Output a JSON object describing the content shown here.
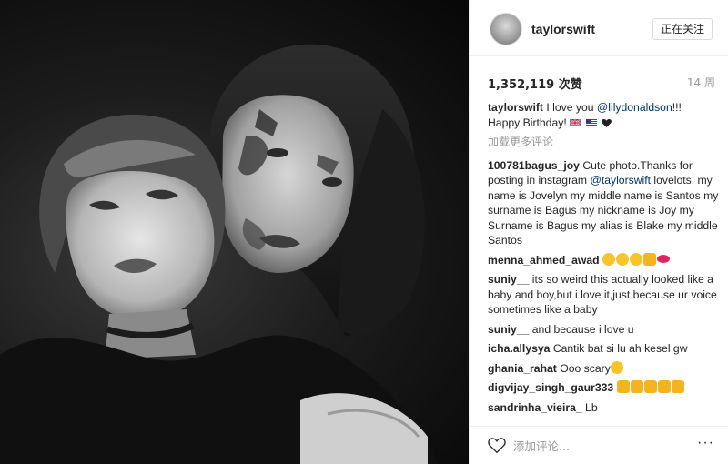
{
  "post": {
    "username": "taylorswift",
    "follow_label": "正在关注",
    "likes": "1,352,119 次赞",
    "timestamp": "14 周"
  },
  "caption": {
    "username": "taylorswift",
    "text_before": " I love you ",
    "mention": "@lilydonaldson",
    "text_after": "!!!",
    "line2": "Happy Birthday! "
  },
  "load_more": "加载更多评论",
  "comments": [
    {
      "user": "100781bagus_joy",
      "text_a": " Cute photo.Thanks for posting in instagram ",
      "mention": "@taylorswift",
      "text_b": " lovelots, my name is Jovelyn my middle name is Santos my surname is Bagus my nickname is Joy my Surname is Bagus my alias is Blake my middle Santos"
    },
    {
      "user": "menna_ahmed_awad",
      "text": " "
    },
    {
      "user": "suniy__",
      "text": " its so weird this actually looked like a baby and boy,but i love it,just because ur voice sometimes like a baby"
    },
    {
      "user": "suniy__",
      "text": " and because i love u"
    },
    {
      "user": "icha.allysya",
      "text": " Cantik bat si lu ah kesel gw"
    },
    {
      "user": "ghania_rahat",
      "text": " Ooo scary"
    },
    {
      "user": "digvijay_singh_gaur333",
      "text": " "
    },
    {
      "user": "sandrinha_vieira_",
      "text": " Lb"
    }
  ],
  "footer": {
    "placeholder": "添加评论...",
    "more": "···"
  },
  "icons": {
    "heart": "heart-outline-icon",
    "flag_uk": "uk-flag-icon",
    "flag_us": "us-flag-icon",
    "black_heart": "black-heart-icon",
    "heart_eyes": "heart-eyes-emoji",
    "thumbs_up": "thumbs-up-emoji",
    "lips": "lips-emoji",
    "scream": "scream-emoji"
  },
  "colors": {
    "link": "#003569",
    "muted": "#999999",
    "text": "#262626",
    "border": "#efefef"
  }
}
